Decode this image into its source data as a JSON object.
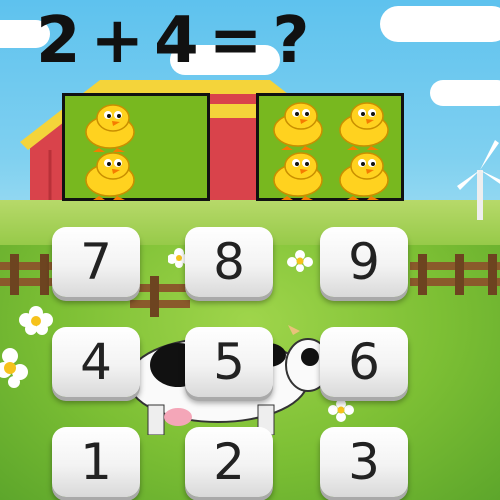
{
  "equation": {
    "left": "2",
    "operator": "+",
    "right": "4",
    "equals": "=",
    "unknown": "?"
  },
  "counting_panels": [
    {
      "chick_count": 2
    },
    {
      "chick_count": 4
    }
  ],
  "answer_keys": [
    {
      "label": "7"
    },
    {
      "label": "8"
    },
    {
      "label": "9"
    },
    {
      "label": "4"
    },
    {
      "label": "5"
    },
    {
      "label": "6"
    },
    {
      "label": "1"
    },
    {
      "label": "2"
    },
    {
      "label": "3"
    }
  ],
  "colors": {
    "sky": "#5ec2ee",
    "grass": "#7cbf34",
    "panel": "#78b81f",
    "barn_red": "#d9434b",
    "chick_yellow": "#ffd21f"
  }
}
